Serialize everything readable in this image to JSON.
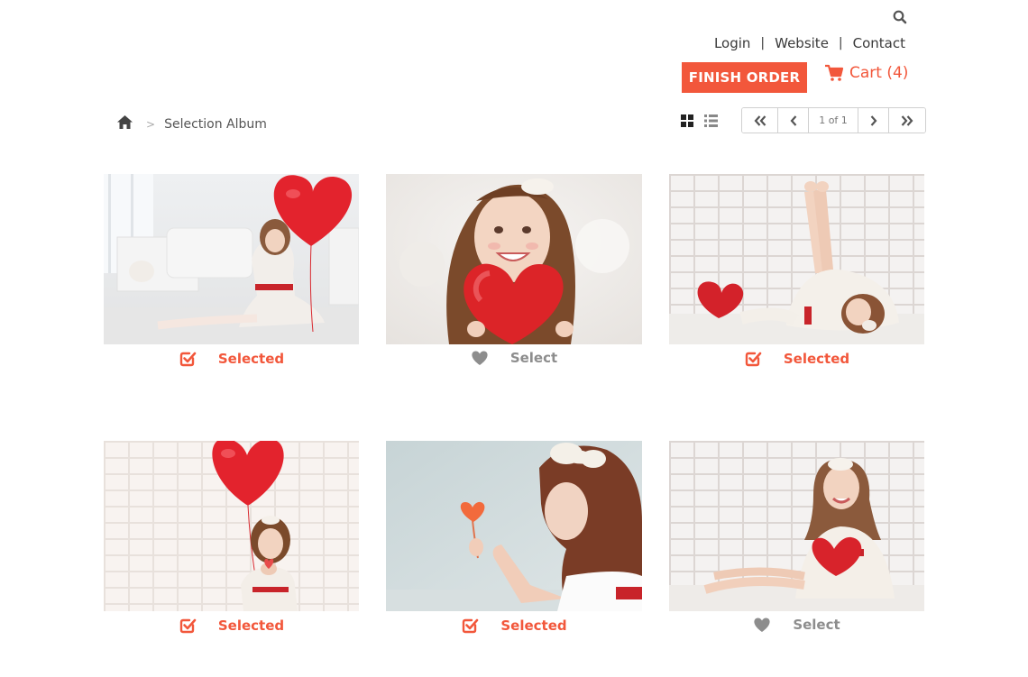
{
  "header": {
    "search_icon": "search-icon",
    "links": {
      "login": "Login",
      "website": "Website",
      "contact": "Contact",
      "separator": "|"
    },
    "finish_order": "FINISH ORDER",
    "cart_label": "Cart (4)"
  },
  "breadcrumb": {
    "home_icon": "home-icon",
    "current": "Selection Album",
    "chevron": ">"
  },
  "pager": {
    "page_label": "1 of 1"
  },
  "colors": {
    "accent": "#f2573b",
    "muted": "#8d8d8d"
  },
  "photos": [
    {
      "status": "Selected",
      "selected": true
    },
    {
      "status": "Select",
      "selected": false
    },
    {
      "status": "Selected",
      "selected": true
    },
    {
      "status": "Selected",
      "selected": true
    },
    {
      "status": "Selected",
      "selected": true
    },
    {
      "status": "Select",
      "selected": false
    }
  ]
}
